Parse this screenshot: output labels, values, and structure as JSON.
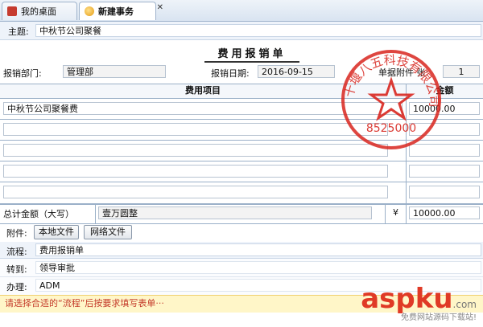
{
  "tabs": [
    {
      "label": "我的桌面"
    },
    {
      "label": "新建事务"
    }
  ],
  "tab_close": "✕",
  "subject": {
    "label": "主题:",
    "value": "中秋节公司聚餐"
  },
  "form": {
    "title": "费用报销单",
    "dept_label": "报销部门:",
    "dept_value": "管理部",
    "date_label": "报销日期:",
    "date_value": "2016-09-15",
    "attach_count_label": "单据附件 张:",
    "attach_count_value": "1"
  },
  "table": {
    "col_item": "费用项目",
    "col_amount": "金额",
    "rows": [
      {
        "item": "中秋节公司聚餐费",
        "amount": "10000.00"
      },
      {
        "item": "",
        "amount": ""
      },
      {
        "item": "",
        "amount": ""
      },
      {
        "item": "",
        "amount": ""
      },
      {
        "item": "",
        "amount": ""
      }
    ],
    "total_label": "总计金额（大写）",
    "total_upper": "壹万圆整",
    "currency_symbol": "¥",
    "total_value": "10000.00"
  },
  "attachments": {
    "label": "附件:",
    "local_btn": "本地文件",
    "net_btn": "网络文件"
  },
  "workflow": {
    "flow_label": "流程:",
    "flow_value": "费用报销单",
    "to_label": "转到:",
    "to_value": "领导审批",
    "handler_label": "办理:",
    "handler_value": "ADM"
  },
  "notice": "请选择合适的“流程”后按要求填写表单···",
  "seal": {
    "text": "十堰八五科技有限公司",
    "number": "8525000",
    "color": "#d8261f"
  },
  "watermark": {
    "brand": "aspku",
    "suffix": ".com",
    "tagline": "免费网站源码下载站!"
  }
}
